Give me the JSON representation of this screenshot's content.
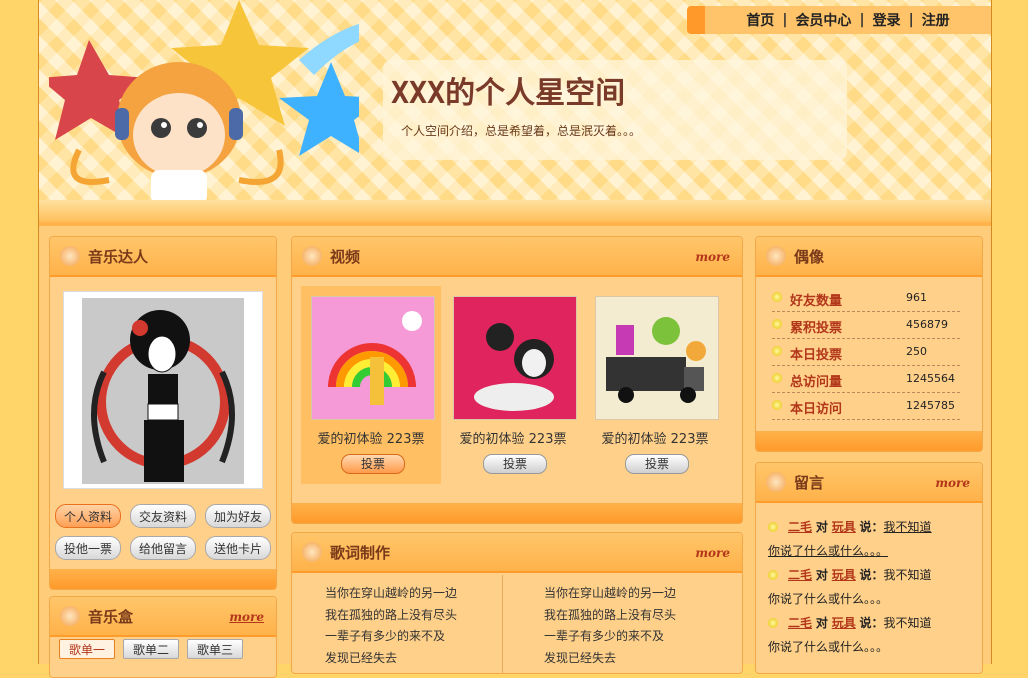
{
  "nav": {
    "home": "首页",
    "member": "会员中心",
    "login": "登录",
    "register": "注册"
  },
  "site": {
    "title": "XXX的个人星空间",
    "intro": "个人空间介绍，总是希望着，总是泯灭着。。。"
  },
  "music_expert": {
    "title": "音乐达人",
    "buttons": [
      "个人资料",
      "交友资料",
      "加为好友",
      "投他一票",
      "给他留言",
      "送他卡片"
    ]
  },
  "music_box": {
    "title": "音乐盒",
    "more": "more",
    "tabs": [
      "歌单一",
      "歌单二",
      "歌单三"
    ]
  },
  "video": {
    "title": "视频",
    "more": "more",
    "items": [
      {
        "caption": "爱的初体验 223票",
        "vote": "投票"
      },
      {
        "caption": "爱的初体验 223票",
        "vote": "投票"
      },
      {
        "caption": "爱的初体验 223票",
        "vote": "投票"
      }
    ]
  },
  "lyrics": {
    "title": "歌词制作",
    "more": "more",
    "left": [
      "当你在穿山越岭的另一边",
      "我在孤独的路上没有尽头",
      "一辈子有多少的来不及",
      "发现已经失去"
    ],
    "right": [
      "当你在穿山越岭的另一边",
      "我在孤独的路上没有尽头",
      "一辈子有多少的来不及",
      "发现已经失去"
    ]
  },
  "idol": {
    "title": "偶像",
    "stats": [
      {
        "label": "好友数量",
        "value": "961"
      },
      {
        "label": "累积投票",
        "value": "456879"
      },
      {
        "label": "本日投票",
        "value": "250"
      },
      {
        "label": "总访问量",
        "value": "1245564"
      },
      {
        "label": "本日访问",
        "value": "1245785"
      }
    ]
  },
  "guestbook": {
    "title": "留言",
    "more": "more",
    "items": [
      {
        "from": "二毛",
        "to_word": "对",
        "to": "玩具",
        "said": "说：",
        "line1": "我不知道",
        "line2": "你说了什么或什么。。。"
      },
      {
        "from": "二毛",
        "to_word": "对",
        "to": "玩具",
        "said": "说：",
        "line1": "我不知道",
        "line2": "你说了什么或什么。。。"
      },
      {
        "from": "二毛",
        "to_word": "对",
        "to": "玩具",
        "said": "说：",
        "line1": "我不知道",
        "line2": "你说了什么或什么。。。"
      }
    ]
  },
  "colors": {
    "accent": "#ff9a2a",
    "title_red": "#b2361a",
    "panel_bg": "#ffd08a"
  }
}
